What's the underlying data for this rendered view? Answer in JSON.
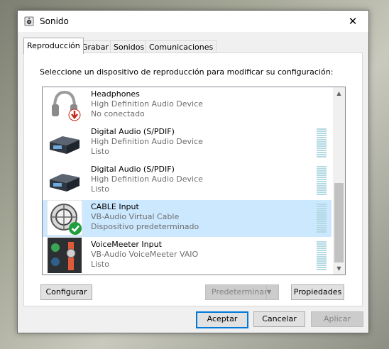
{
  "window": {
    "title": "Sonido",
    "close_symbol": "✕"
  },
  "tabs": [
    {
      "label": "Reproducción"
    },
    {
      "label": "Grabar"
    },
    {
      "label": "Sonidos"
    },
    {
      "label": "Comunicaciones"
    }
  ],
  "instruction": "Seleccione un dispositivo de reproducción para modificar su configuración:",
  "devices": [
    {
      "name": "Headphones",
      "description": "High Definition Audio Device",
      "status": "No conectado",
      "icon": "headphones-icon"
    },
    {
      "name": "Digital Audio (S/PDIF)",
      "description": "High Definition Audio Device",
      "status": "Listo",
      "icon": "digital-audio-icon"
    },
    {
      "name": "Digital Audio (S/PDIF)",
      "description": "High Definition Audio Device",
      "status": "Listo",
      "icon": "digital-audio-icon"
    },
    {
      "name": "CABLE Input",
      "description": "VB-Audio Virtual Cable",
      "status": "Dispositivo predeterminado",
      "icon": "cable-input-icon",
      "selected": true
    },
    {
      "name": "VoiceMeeter Input",
      "description": "VB-Audio VoiceMeeter VAIO",
      "status": "Listo",
      "icon": "voicemeeter-icon"
    }
  ],
  "buttons": {
    "configure": "Configurar",
    "set_default": "Predeterminar",
    "properties": "Propiedades",
    "accept": "Aceptar",
    "cancel": "Cancelar",
    "apply": "Aplicar"
  },
  "colors": {
    "selection": "#cce8ff",
    "accent": "#0078d7",
    "meter": "#b3d9e2"
  }
}
